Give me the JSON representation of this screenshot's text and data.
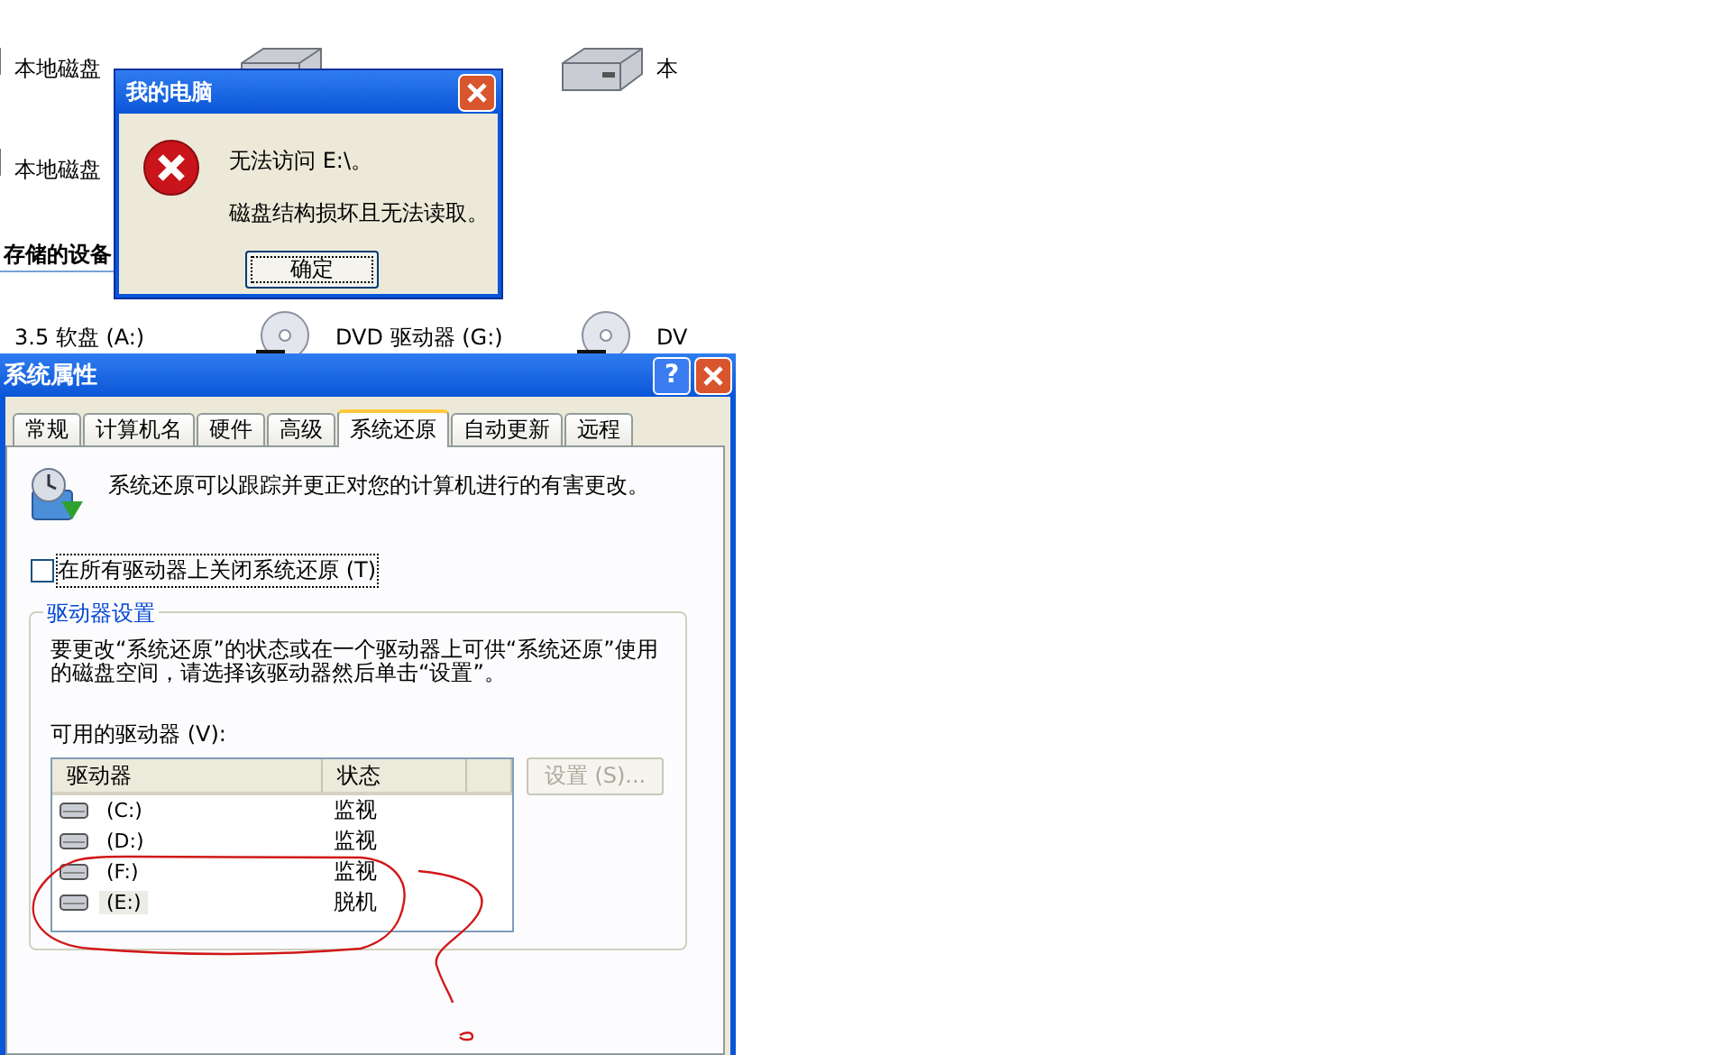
{
  "explorer": {
    "rows": [
      {
        "items": [
          {
            "kind": "drive",
            "label": "本地磁盘"
          },
          {
            "kind": "drive"
          },
          {
            "kind": "drive",
            "label": "本"
          }
        ]
      },
      {
        "items": [
          {
            "kind": "drive",
            "label": "本地磁盘"
          }
        ]
      },
      {
        "heading": "存储的设备"
      },
      {
        "items": [
          {
            "kind": "floppy",
            "label": "3.5 软盘 (A:)"
          },
          {
            "kind": "dvd",
            "label": "DVD 驱动器 (G:)"
          },
          {
            "kind": "dvd",
            "label": "DV"
          }
        ]
      }
    ]
  },
  "message_box": {
    "title": "我的电脑",
    "lines": [
      "无法访问 E:\\。",
      "磁盘结构损坏且无法读取。"
    ],
    "button": "确定"
  },
  "system_properties": {
    "title": "系统属性",
    "help_button": "?",
    "tabs": [
      {
        "label": "常规",
        "selected": false
      },
      {
        "label": "计算机名",
        "selected": false
      },
      {
        "label": "硬件",
        "selected": false
      },
      {
        "label": "高级",
        "selected": false
      },
      {
        "label": "系统还原",
        "selected": true
      },
      {
        "label": "自动更新",
        "selected": false
      },
      {
        "label": "远程",
        "selected": false
      }
    ],
    "intro": "系统还原可以跟踪并更正对您的计算机进行的有害更改。",
    "checkbox": {
      "label": "在所有驱动器上关闭系统还原 (T)",
      "checked": false
    },
    "group": {
      "title": "驱动器设置",
      "text": "要更改“系统还原”的状态或在一个驱动器上可供“系统还原”使用的磁盘空间，请选择该驱动器然后单击“设置”。",
      "list_label": "可用的驱动器 (V):",
      "columns": [
        "驱动器",
        "状态"
      ],
      "rows": [
        {
          "drive": "(C:)",
          "status": "监视",
          "selected": false
        },
        {
          "drive": "(D:)",
          "status": "监视",
          "selected": false
        },
        {
          "drive": "(F:)",
          "status": "监视",
          "selected": false
        },
        {
          "drive": "(E:)",
          "status": "脱机",
          "selected": true
        }
      ],
      "settings_button": {
        "label": "设置 (S)...",
        "disabled": true
      }
    }
  }
}
